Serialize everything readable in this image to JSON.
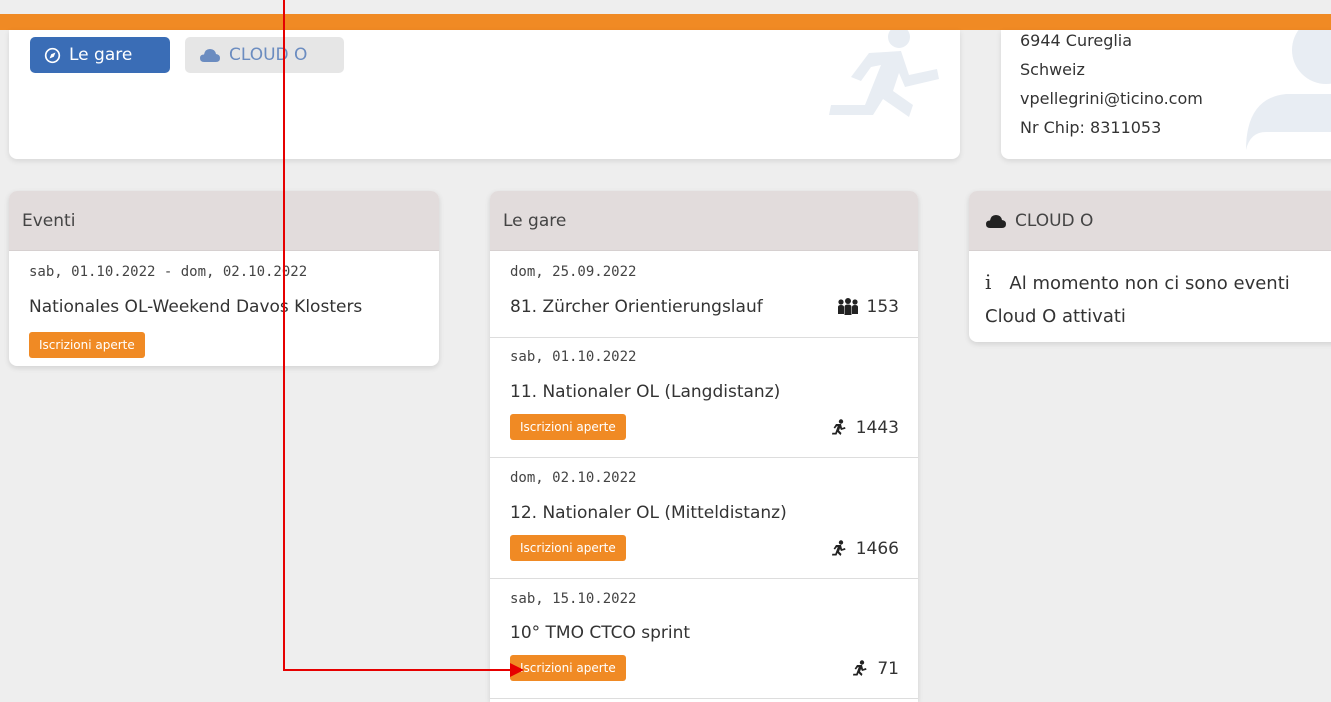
{
  "top_card": {
    "btn_le_gare": "Le gare",
    "btn_cloud": "CLOUD O"
  },
  "profile": {
    "lines": [
      "6944 Cureglia",
      "Schweiz",
      "vpellegrini@ticino.com",
      "Nr Chip: 8311053"
    ]
  },
  "eventi": {
    "header": "Eventi",
    "items": [
      {
        "date": "sab, 01.10.2022 - dom, 02.10.2022",
        "title": "Nationales OL-Weekend Davos Klosters",
        "badge": "Iscrizioni aperte"
      }
    ]
  },
  "gare": {
    "header": "Le gare",
    "items": [
      {
        "date": "dom, 25.09.2022",
        "title": "81. Zürcher Orientierungslauf",
        "badge": "",
        "count": "153",
        "icon": "group-icon"
      },
      {
        "date": "sab, 01.10.2022",
        "title": "11. Nationaler OL (Langdistanz)",
        "badge": "Iscrizioni aperte",
        "count": "1443",
        "icon": "runner-icon"
      },
      {
        "date": "dom, 02.10.2022",
        "title": "12. Nationaler OL (Mitteldistanz)",
        "badge": "Iscrizioni aperte",
        "count": "1466",
        "icon": "runner-icon"
      },
      {
        "date": "sab, 15.10.2022",
        "title": "10° TMO CTCO sprint",
        "badge": "Iscrizioni aperte",
        "count": "71",
        "icon": "runner-icon"
      }
    ]
  },
  "cloud": {
    "header": "CLOUD O",
    "message_line1": "Al momento non ci sono eventi",
    "message_line2": "Cloud O attivati"
  },
  "colors": {
    "accent": "#f08a24",
    "primary": "#3a6db6",
    "annotation": "#e60000"
  }
}
